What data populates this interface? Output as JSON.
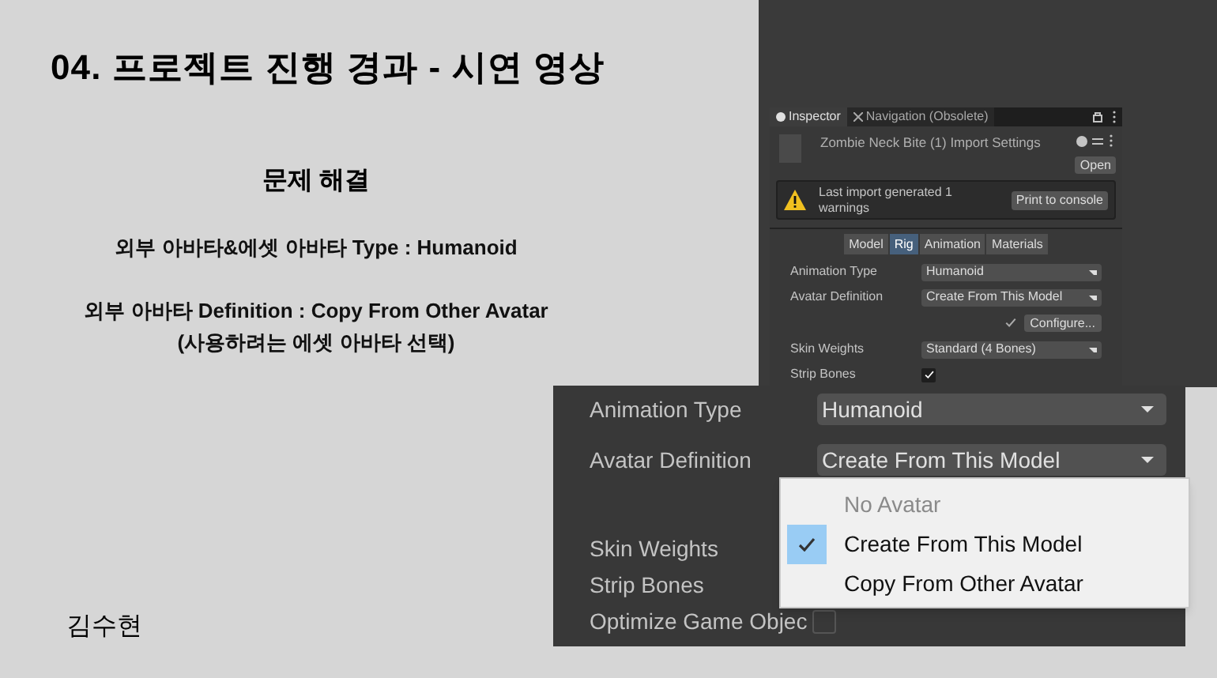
{
  "slide": {
    "title": "04. 프로젝트 진행 경과 - 시연 영상",
    "heading": "문제 해결",
    "paragraphs": [
      [
        "외부 아바타&에셋 아바타 Type : Humanoid"
      ],
      [
        "외부 아바타 Definition : Copy From Other Avatar",
        "(사용하려는 에셋 아바타 선택)"
      ]
    ],
    "author": "김수현"
  },
  "inspector": {
    "tabs": [
      {
        "label": "Inspector",
        "selected": true
      },
      {
        "label": "Navigation (Obsolete)",
        "selected": false
      }
    ],
    "asset_title": "Zombie Neck Bite (1) Import Settings",
    "open_button": "Open",
    "warning": {
      "message": "Last import generated 1 warnings",
      "button": "Print to console"
    },
    "subtabs": [
      {
        "label": "Model",
        "selected": false
      },
      {
        "label": "Rig",
        "selected": true
      },
      {
        "label": "Animation",
        "selected": false
      },
      {
        "label": "Materials",
        "selected": false
      }
    ],
    "fields": [
      {
        "kind": "dropdown",
        "label": "Animation Type",
        "value": "Humanoid"
      },
      {
        "kind": "dropdown",
        "label": "Avatar Definition",
        "value": "Create From This Model"
      },
      {
        "kind": "configure",
        "checked": true,
        "button": "Configure..."
      },
      {
        "kind": "dropdown",
        "label": "Skin Weights",
        "value": "Standard (4 Bones)"
      },
      {
        "kind": "checkbox",
        "label": "Strip Bones",
        "checked": true
      }
    ]
  },
  "zoomed_inspector": {
    "fields": [
      {
        "kind": "dropdown",
        "label": "Animation Type",
        "value": "Humanoid"
      },
      {
        "kind": "dropdown",
        "label": "Avatar Definition",
        "value": "Create From This Model"
      },
      {
        "kind": "spacer"
      },
      {
        "kind": "label",
        "label": "Skin Weights"
      },
      {
        "kind": "label",
        "label": "Strip Bones"
      },
      {
        "kind": "checkbox",
        "label": "Optimize Game Objec",
        "checked": false
      }
    ],
    "menu": {
      "items": [
        {
          "label": "No Avatar",
          "disabled": true,
          "selected": false
        },
        {
          "label": "Create From This Model",
          "disabled": false,
          "selected": true
        },
        {
          "label": "Copy From Other Avatar",
          "disabled": false,
          "selected": false
        }
      ]
    }
  }
}
